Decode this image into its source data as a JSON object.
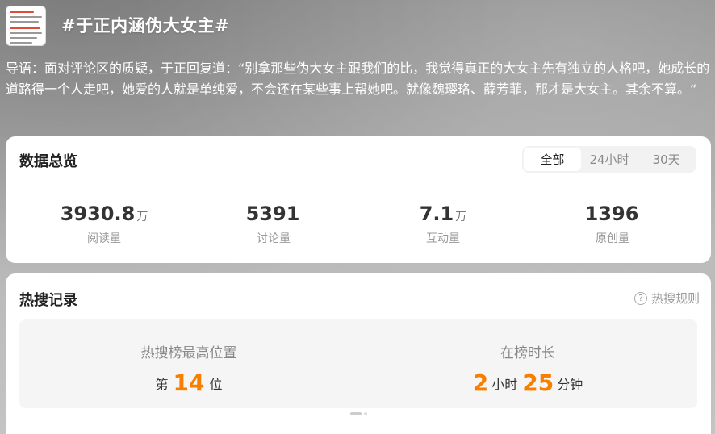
{
  "topic": {
    "title": "#于正内涵伪大女主#",
    "intro": "导语：面对评论区的质疑，于正回复道：“别拿那些伪大女主跟我们的比，我觉得真正的大女主先有独立的人格吧，她成长的道路得一个人走吧，她爱的人就是单纯爱，不会还在某些事上帮她吧。就像魏璎珞、薛芳菲，那才是大女主。其余不算。“"
  },
  "overview": {
    "title": "数据总览",
    "tabs": [
      "全部",
      "24小时",
      "30天"
    ],
    "active_tab": "全部",
    "stats": [
      {
        "value": "3930.8",
        "unit": "万",
        "label": "阅读量"
      },
      {
        "value": "5391",
        "unit": "",
        "label": "讨论量"
      },
      {
        "value": "7.1",
        "unit": "万",
        "label": "互动量"
      },
      {
        "value": "1396",
        "unit": "",
        "label": "原创量"
      }
    ]
  },
  "hot": {
    "title": "热搜记录",
    "help_label": "热搜规则",
    "peak_label": "热搜榜最高位置",
    "peak_prefix": "第",
    "peak_value": "14",
    "peak_suffix": "位",
    "duration_label": "在榜时长",
    "hours_value": "2",
    "hours_unit": "小时",
    "minutes_value": "25",
    "minutes_unit": "分钟"
  },
  "colors": {
    "accent": "#f77f00"
  }
}
